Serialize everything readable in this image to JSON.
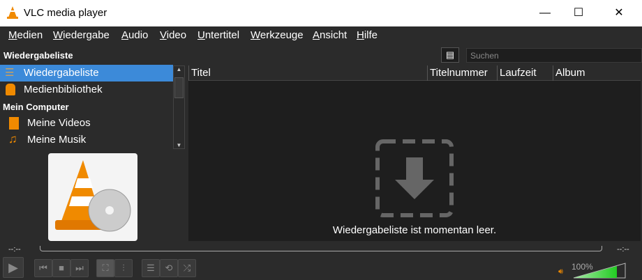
{
  "window": {
    "title": "VLC media player",
    "minimize": "—",
    "maximize": "☐",
    "close": "✕"
  },
  "menu": [
    "Medien",
    "Wiedergabe",
    "Audio",
    "Video",
    "Untertitel",
    "Werkzeuge",
    "Ansicht",
    "Hilfe"
  ],
  "sidebar": {
    "header": "Wiedergabeliste",
    "items": [
      {
        "label": "Wiedergabeliste"
      },
      {
        "label": "Medienbibliothek"
      }
    ],
    "section": "Mein Computer",
    "computer_items": [
      {
        "label": "Meine Videos"
      },
      {
        "label": "Meine Musik"
      }
    ]
  },
  "search": {
    "placeholder": "Suchen"
  },
  "playlist": {
    "columns": [
      "Titel",
      "Titelnummer",
      "Laufzeit",
      "Album"
    ],
    "empty_text": "Wiedergabeliste ist momentan leer."
  },
  "player": {
    "elapsed": "--:--",
    "remaining": "--:--",
    "volume": "100%",
    "volume_fraction": 1.0
  },
  "colors": {
    "accent": "#3c8ad9",
    "orange": "#f08a00",
    "volume": "#22cc22"
  }
}
